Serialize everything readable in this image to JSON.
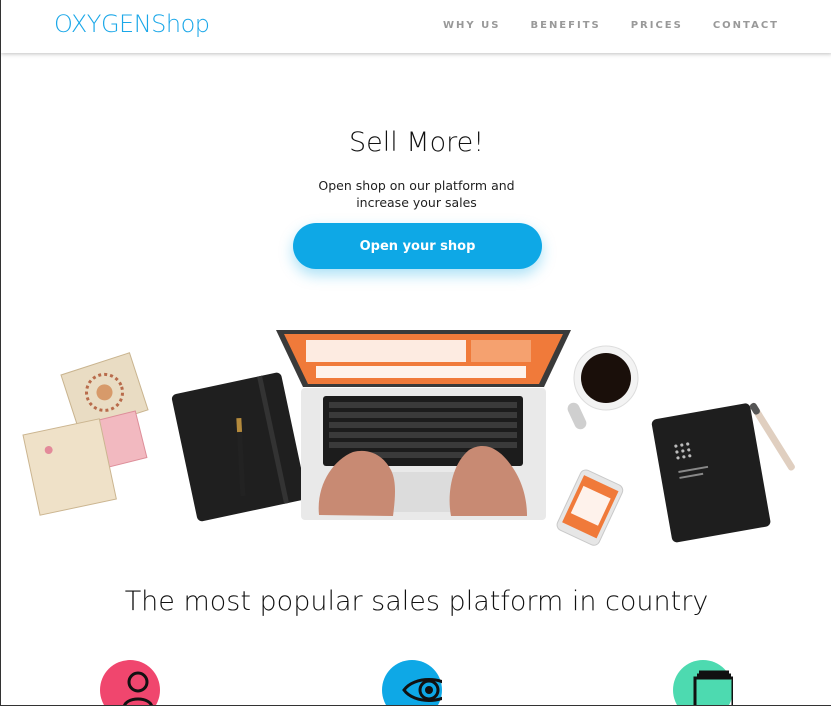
{
  "brand": {
    "logo": "OXYGENShop"
  },
  "nav": {
    "items": [
      {
        "label": "WHY US"
      },
      {
        "label": "BENEFITS"
      },
      {
        "label": "PRICES"
      },
      {
        "label": "CONTACT"
      }
    ]
  },
  "hero": {
    "title": "Sell More!",
    "subtitle_line1": "Open shop on our platform and",
    "subtitle_line2": "increase your sales",
    "cta_label": "Open your shop"
  },
  "features": {
    "title": "The most popular sales platform in country",
    "icons": [
      {
        "name": "user-icon",
        "color": "#f0466e"
      },
      {
        "name": "eye-icon",
        "color": "#0ea8e6"
      },
      {
        "name": "stack-icon",
        "color": "#4ddab0"
      }
    ]
  },
  "colors": {
    "brand": "#1aa7e8",
    "cta": "#0ea8e6",
    "nav_text": "#999999"
  }
}
